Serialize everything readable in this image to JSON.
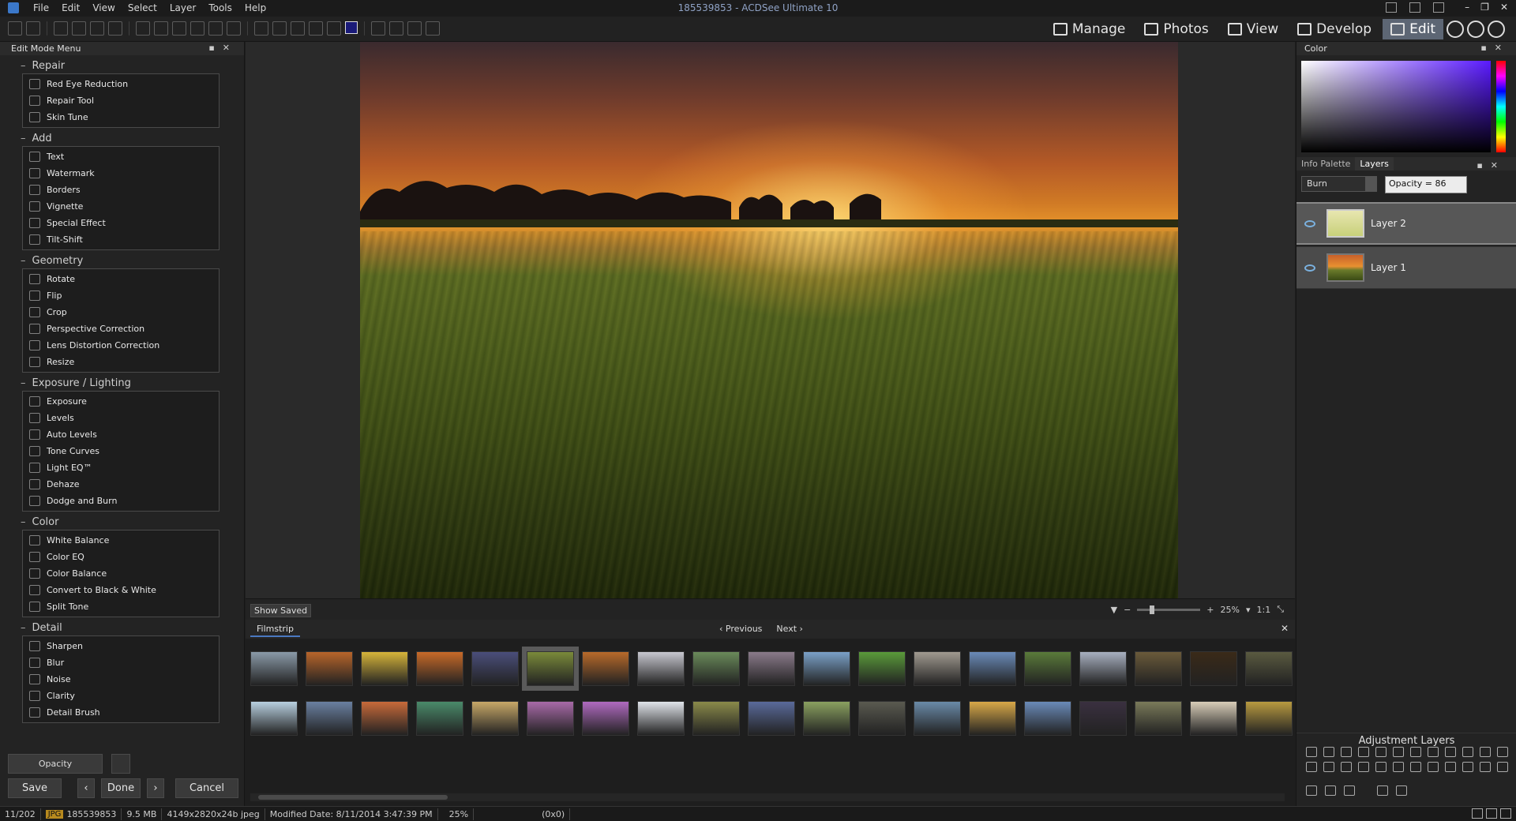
{
  "window": {
    "title": "185539853 - ACDSee Ultimate 10",
    "menu": [
      "File",
      "Edit",
      "View",
      "Select",
      "Layer",
      "Tools",
      "Help"
    ]
  },
  "modes": [
    {
      "label": "Manage",
      "active": false
    },
    {
      "label": "Photos",
      "active": false
    },
    {
      "label": "View",
      "active": false
    },
    {
      "label": "Develop",
      "active": false
    },
    {
      "label": "Edit",
      "active": true
    }
  ],
  "edit_menu": {
    "title": "Edit Mode Menu",
    "groups": [
      {
        "title": "Repair",
        "items": [
          {
            "label": "Red Eye Reduction",
            "icon": "eye-icon"
          },
          {
            "label": "Repair Tool",
            "icon": "bandage-icon"
          },
          {
            "label": "Skin Tune",
            "icon": "person-icon"
          }
        ]
      },
      {
        "title": "Add",
        "items": [
          {
            "label": "Text",
            "icon": "text-icon"
          },
          {
            "label": "Watermark",
            "icon": "watermark-icon"
          },
          {
            "label": "Borders",
            "icon": "border-icon"
          },
          {
            "label": "Vignette",
            "icon": "vignette-icon"
          },
          {
            "label": "Special Effect",
            "icon": "magic-wand-icon"
          },
          {
            "label": "Tilt-Shift",
            "icon": "tilt-shift-icon"
          }
        ]
      },
      {
        "title": "Geometry",
        "items": [
          {
            "label": "Rotate",
            "icon": "rotate-icon"
          },
          {
            "label": "Flip",
            "icon": "flip-icon"
          },
          {
            "label": "Crop",
            "icon": "crop-icon"
          },
          {
            "label": "Perspective Correction",
            "icon": "perspective-icon"
          },
          {
            "label": "Lens Distortion Correction",
            "icon": "lens-icon"
          },
          {
            "label": "Resize",
            "icon": "resize-icon"
          }
        ]
      },
      {
        "title": "Exposure / Lighting",
        "items": [
          {
            "label": "Exposure",
            "icon": "exposure-icon"
          },
          {
            "label": "Levels",
            "icon": "levels-icon"
          },
          {
            "label": "Auto Levels",
            "icon": "auto-levels-icon"
          },
          {
            "label": "Tone Curves",
            "icon": "curves-icon"
          },
          {
            "label": "Light EQ™",
            "icon": "sun-icon"
          },
          {
            "label": "Dehaze",
            "icon": "dehaze-icon"
          },
          {
            "label": "Dodge and Burn",
            "icon": "dodge-burn-icon"
          }
        ]
      },
      {
        "title": "Color",
        "items": [
          {
            "label": "White Balance",
            "icon": "white-balance-icon"
          },
          {
            "label": "Color EQ",
            "icon": "color-eq-icon"
          },
          {
            "label": "Color Balance",
            "icon": "color-balance-icon"
          },
          {
            "label": "Convert to Black & White",
            "icon": "bw-icon"
          },
          {
            "label": "Split Tone",
            "icon": "split-tone-icon"
          }
        ]
      },
      {
        "title": "Detail",
        "items": [
          {
            "label": "Sharpen",
            "icon": "sharpen-icon"
          },
          {
            "label": "Blur",
            "icon": "droplet-icon"
          },
          {
            "label": "Noise",
            "icon": "noise-icon"
          },
          {
            "label": "Clarity",
            "icon": "clarity-icon"
          },
          {
            "label": "Detail Brush",
            "icon": "brush-icon"
          }
        ]
      }
    ],
    "opacity_label": "Opacity",
    "save_label": "Save",
    "done_label": "Done",
    "cancel_label": "Cancel"
  },
  "canvas": {
    "show_saved": "Show Saved",
    "zoom": "25%",
    "ratio": "1:1"
  },
  "filmstrip": {
    "tab": "Filmstrip",
    "previous": "Previous",
    "next": "Next",
    "row1_colors": [
      "#8a9aa8",
      "#b8652a",
      "#d6b43a",
      "#c86a28",
      "#4a4e7a",
      "#7a8a3a",
      "#b86a2a",
      "#c8c8d0",
      "#6a8a5a",
      "#8a7a8a",
      "#7aa0c8",
      "#5a9a3a",
      "#a09a90",
      "#6a8ab8",
      "#5a7a3a",
      "#a8b0c0",
      "#6a5a3a",
      "#3a2a18",
      "#5a5a40"
    ],
    "row2_colors": [
      "#b8d0e0",
      "#6a80a0",
      "#c86a3a",
      "#4a8a6a",
      "#c8a868",
      "#a86aa8",
      "#b06ac0",
      "#e0e4ea",
      "#8a8a4a",
      "#5a6a9a",
      "#8aa060",
      "#5a5a50",
      "#6a8aa8",
      "#d8a848",
      "#6a8ab8",
      "#3a3040",
      "#7a7a5a",
      "#d8cdb8",
      "#b89a40"
    ]
  },
  "color_panel": {
    "title": "Color"
  },
  "layers_panel": {
    "tabs": [
      "Info Palette",
      "Layers"
    ],
    "blend_mode": "Burn",
    "opacity": "Opacity = 86",
    "layers": [
      {
        "name": "Layer 2",
        "selected": true
      },
      {
        "name": "Layer 1",
        "selected": false
      }
    ],
    "adjustment_title": "Adjustment Layers"
  },
  "status": {
    "index": "11/202",
    "type": "JPG",
    "filename": "185539853",
    "size": "9.5 MB",
    "dimensions": "4149x2820x24b jpeg",
    "modified": "Modified Date: 8/11/2014 3:47:39 PM",
    "zoom": "25%",
    "coords": "(0x0)"
  }
}
